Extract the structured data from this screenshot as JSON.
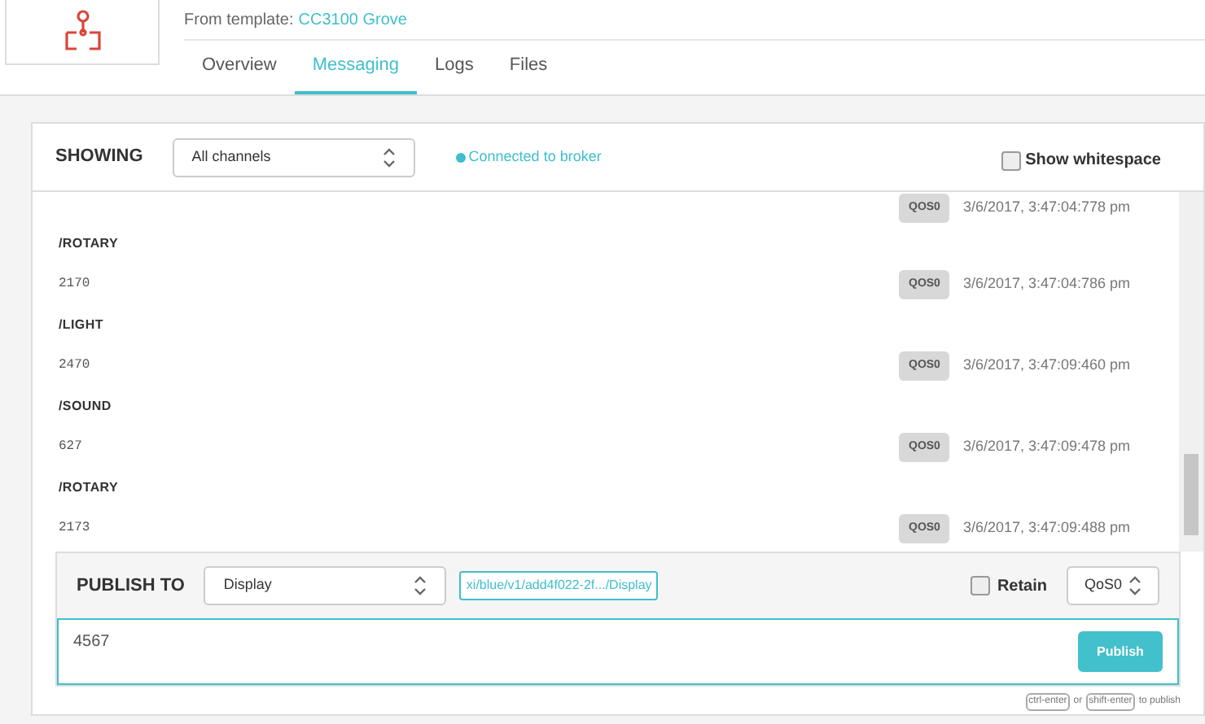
{
  "header": {
    "template_label": "From template:",
    "template_link": "CC3100 Grove"
  },
  "tabs": [
    {
      "label": "Overview",
      "selected": false
    },
    {
      "label": "Messaging",
      "selected": true
    },
    {
      "label": "Logs",
      "selected": false
    },
    {
      "label": "Files",
      "selected": false
    }
  ],
  "toolbar": {
    "showing_label": "SHOWING",
    "channel_select": "All channels",
    "status": "Connected to broker",
    "show_whitespace": {
      "label": "Show whitespace",
      "checked": false
    }
  },
  "partial_row": {
    "qos": "QOS0",
    "time": "3/6/2017, 3:47:04:778 pm"
  },
  "messages": [
    {
      "topic": "/ROTARY",
      "payload": "2170",
      "qos": "QOS0",
      "time": "3/6/2017, 3:47:04:786 pm"
    },
    {
      "topic": "/LIGHT",
      "payload": "2470",
      "qos": "QOS0",
      "time": "3/6/2017, 3:47:09:460 pm"
    },
    {
      "topic": "/SOUND",
      "payload": "627",
      "qos": "QOS0",
      "time": "3/6/2017, 3:47:09:478 pm"
    },
    {
      "topic": "/ROTARY",
      "payload": "2173",
      "qos": "QOS0",
      "time": "3/6/2017, 3:47:09:488 pm"
    }
  ],
  "publish": {
    "label": "PUBLISH TO",
    "channel_select": "Display",
    "topic": "xi/blue/v1/add4f022-2f.../Display",
    "retain": {
      "label": "Retain",
      "checked": false
    },
    "qos_select": "QoS0",
    "value": "4567",
    "button": "Publish"
  },
  "hint": {
    "key1": "ctrl-enter",
    "or": "or",
    "key2": "shift-enter",
    "suffix": "to publish"
  }
}
